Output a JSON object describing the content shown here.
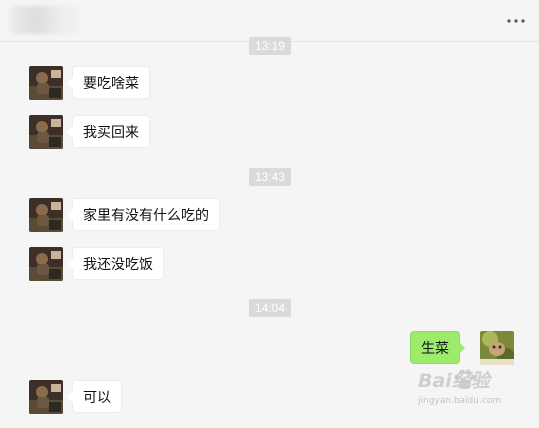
{
  "header": {
    "title": "",
    "more_icon": "more-dots-icon"
  },
  "messages": [
    {
      "type": "time",
      "text": "13:19"
    },
    {
      "type": "msg",
      "side": "left",
      "text": "要吃啥菜"
    },
    {
      "type": "msg",
      "side": "left",
      "text": "我买回来"
    },
    {
      "type": "time",
      "text": "13:43"
    },
    {
      "type": "msg",
      "side": "left",
      "text": "家里有没有什么吃的"
    },
    {
      "type": "msg",
      "side": "left",
      "text": "我还没吃饭"
    },
    {
      "type": "time",
      "text": "14:04"
    },
    {
      "type": "msg",
      "side": "right",
      "text": "生菜"
    },
    {
      "type": "msg",
      "side": "left",
      "text": "可以"
    }
  ],
  "watermark": {
    "logo": "Bai经验",
    "url": "jingyan.baidu.com"
  },
  "colors": {
    "background": "#f5f5f5",
    "bubble_left": "#ffffff",
    "bubble_right": "#9eea6a",
    "timestamp_bg": "#dadada",
    "timestamp_text": "#ffffff"
  }
}
